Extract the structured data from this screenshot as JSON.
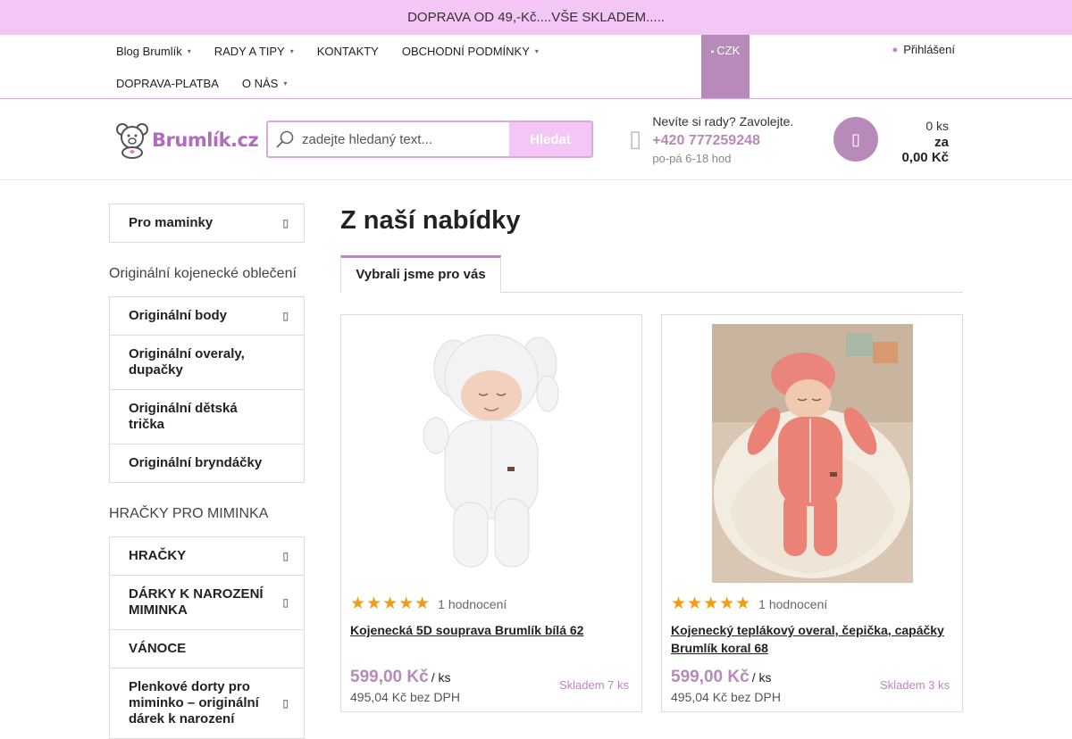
{
  "promo": "DOPRAVA OD 49,-Kč....VŠE SKLADEM.....",
  "topnav": {
    "row1": [
      {
        "label": "Blog Brumlík",
        "dropdown": true
      },
      {
        "label": "RADY A TIPY",
        "dropdown": true
      },
      {
        "label": "KONTAKTY",
        "dropdown": false
      },
      {
        "label": "OBCHODNÍ PODMÍNKY",
        "dropdown": true
      }
    ],
    "row2": [
      {
        "label": "DOPRAVA-PLATBA",
        "dropdown": false
      },
      {
        "label": "O NÁS",
        "dropdown": true
      }
    ],
    "currency": "CZK",
    "login": "Přihlášení"
  },
  "header": {
    "logo_text": "Brumlík.cz",
    "search_placeholder": "zadejte hledaný text...",
    "search_button": "Hledat",
    "contact_title": "Nevíte si rady? Zavolejte.",
    "phone": "+420 777259248",
    "hours": "po-pá 6-18 hod",
    "cart_count": "0 ks",
    "cart_za": "za",
    "cart_sum": "0,00 Kč"
  },
  "sidebar": {
    "group1": [
      {
        "label": "Pro maminky",
        "arrow": true
      }
    ],
    "title2": "Originální kojenecké oblečení",
    "group2": [
      {
        "label": "Originální body",
        "arrow": true
      },
      {
        "label": "Originální overaly, dupačky",
        "arrow": false
      },
      {
        "label": "Originální dětská trička",
        "arrow": false
      },
      {
        "label": "Originální bryndáčky",
        "arrow": false
      }
    ],
    "title3": "HRAČKY PRO MIMINKA",
    "group3": [
      {
        "label": "HRAČKY",
        "arrow": true
      },
      {
        "label": "DÁRKY K NAROZENÍ MIMINKA",
        "arrow": true
      },
      {
        "label": "VÁNOCE",
        "arrow": false
      },
      {
        "label": "Plenkové dorty pro miminko – originální dárek k narození",
        "arrow": true
      }
    ]
  },
  "main": {
    "title": "Z naší nabídky",
    "tab": "Vybrali jsme pro vás",
    "products": [
      {
        "name": "Kojenecká 5D souprava Brumlík bílá 62",
        "rating_count": "1 hodnocení",
        "stars": 5,
        "price": "599,00 Kč",
        "unit": "/ ks",
        "price_without_vat": "495,04 Kč bez DPH",
        "stock": "Skladem 7 ks"
      },
      {
        "name": "Kojenecký teplákový overal, čepička, capáčky Brumlík koral 68",
        "rating_count": "1 hodnocení",
        "stars": 5,
        "price": "599,00 Kč",
        "unit": "/ ks",
        "price_without_vat": "495,04 Kč bez DPH",
        "stock": "Skladem 3 ks"
      }
    ]
  },
  "colors": {
    "promo_bg": "#f3c6f6",
    "accent": "#b78ab9",
    "star": "#f39c12"
  }
}
